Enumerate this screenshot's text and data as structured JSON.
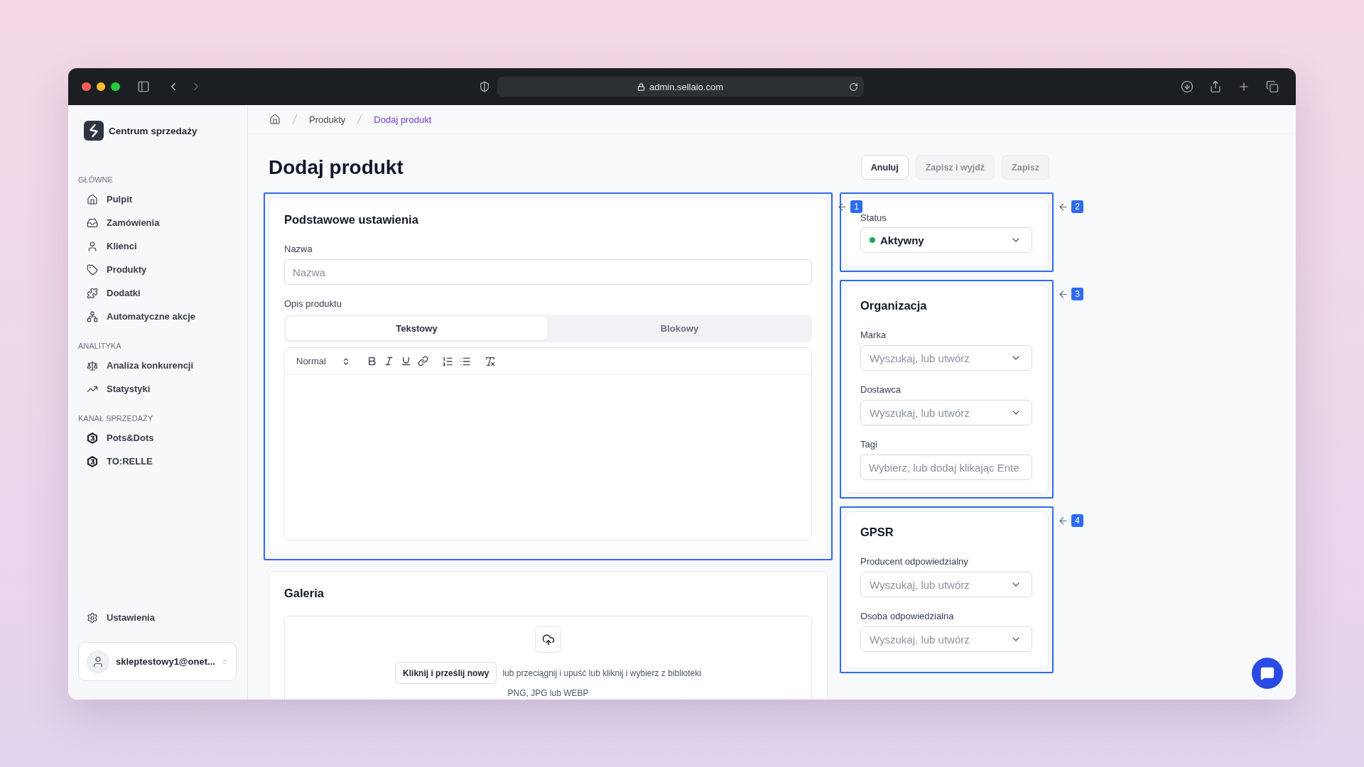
{
  "browser": {
    "url": "admin.sellaio.com"
  },
  "sidebar": {
    "brand": "Centrum sprzedaży",
    "sections": [
      {
        "title": "GŁÓWNE",
        "items": [
          {
            "label": "Pulpit",
            "selected": false
          },
          {
            "label": "Zamówienia",
            "selected": false
          },
          {
            "label": "Klienci",
            "selected": false
          },
          {
            "label": "Produkty",
            "selected": false
          },
          {
            "label": "Dodatki",
            "selected": false
          },
          {
            "label": "Automatyczne akcje",
            "selected": false
          }
        ]
      },
      {
        "title": "ANALITYKA",
        "items": [
          {
            "label": "Analiza konkurencji",
            "selected": false
          },
          {
            "label": "Statystyki",
            "selected": false
          }
        ]
      },
      {
        "title": "KANAŁ SPRZEDAŻY",
        "items": [
          {
            "label": "Pots&Dots",
            "selected": false
          },
          {
            "label": "TO:RELLE",
            "selected": false
          }
        ]
      }
    ],
    "settings": {
      "label": "Ustawienia",
      "selected": false
    },
    "account": {
      "email": "skleptestowy1@onet..."
    }
  },
  "breadcrumb": {
    "items": [
      {
        "label": "Produkty",
        "current": false
      },
      {
        "label": "Dodaj produkt",
        "current": true
      }
    ]
  },
  "page": {
    "title": "Dodaj produkt",
    "buttons": [
      {
        "label": "Anuluj",
        "disabled": false
      },
      {
        "label": "Zapisz i wyjdź",
        "disabled": true
      },
      {
        "label": "Zapisz",
        "disabled": true
      }
    ]
  },
  "basic_settings": {
    "callout": "1",
    "title": "Podstawowe ustawienia",
    "name_field": {
      "label": "Nazwa",
      "placeholder": "Nazwa"
    },
    "description": {
      "label": "Opis produktu",
      "tabs": [
        {
          "label": "Tekstowy",
          "selected": true
        },
        {
          "label": "Blokowy",
          "selected": false
        }
      ],
      "toolbar": {
        "format": "Normal"
      }
    }
  },
  "gallery": {
    "title": "Galeria",
    "upload_button": "Kliknij i prześlij nowy",
    "hint": "lub przeciągnij i upuść lub kliknij i wybierz z biblioteki",
    "formats": "PNG, JPG lub WEBP"
  },
  "status_panel": {
    "callout": "2",
    "label": "Status",
    "value": "Aktywny",
    "color": "#22a45d"
  },
  "organization": {
    "callout": "3",
    "title": "Organizacja",
    "fields": [
      {
        "kind": "select",
        "label": "Marka",
        "placeholder": "Wyszukaj, lub utwórz"
      },
      {
        "kind": "select",
        "label": "Dostawca",
        "placeholder": "Wyszukaj, lub utwórz"
      },
      {
        "kind": "input",
        "label": "Tagi",
        "placeholder": "Wybierz, lub dodaj klikając Ente"
      }
    ]
  },
  "gpsr": {
    "callout": "4",
    "title": "GPSR",
    "fields": [
      {
        "kind": "select",
        "label": "Producent odpowiedzialny",
        "placeholder": "Wyszukaj, lub utwórz"
      },
      {
        "kind": "select",
        "label": "Osoba odpowiedzialna",
        "placeholder": "Wyszukaj, lub utwórz"
      }
    ]
  }
}
